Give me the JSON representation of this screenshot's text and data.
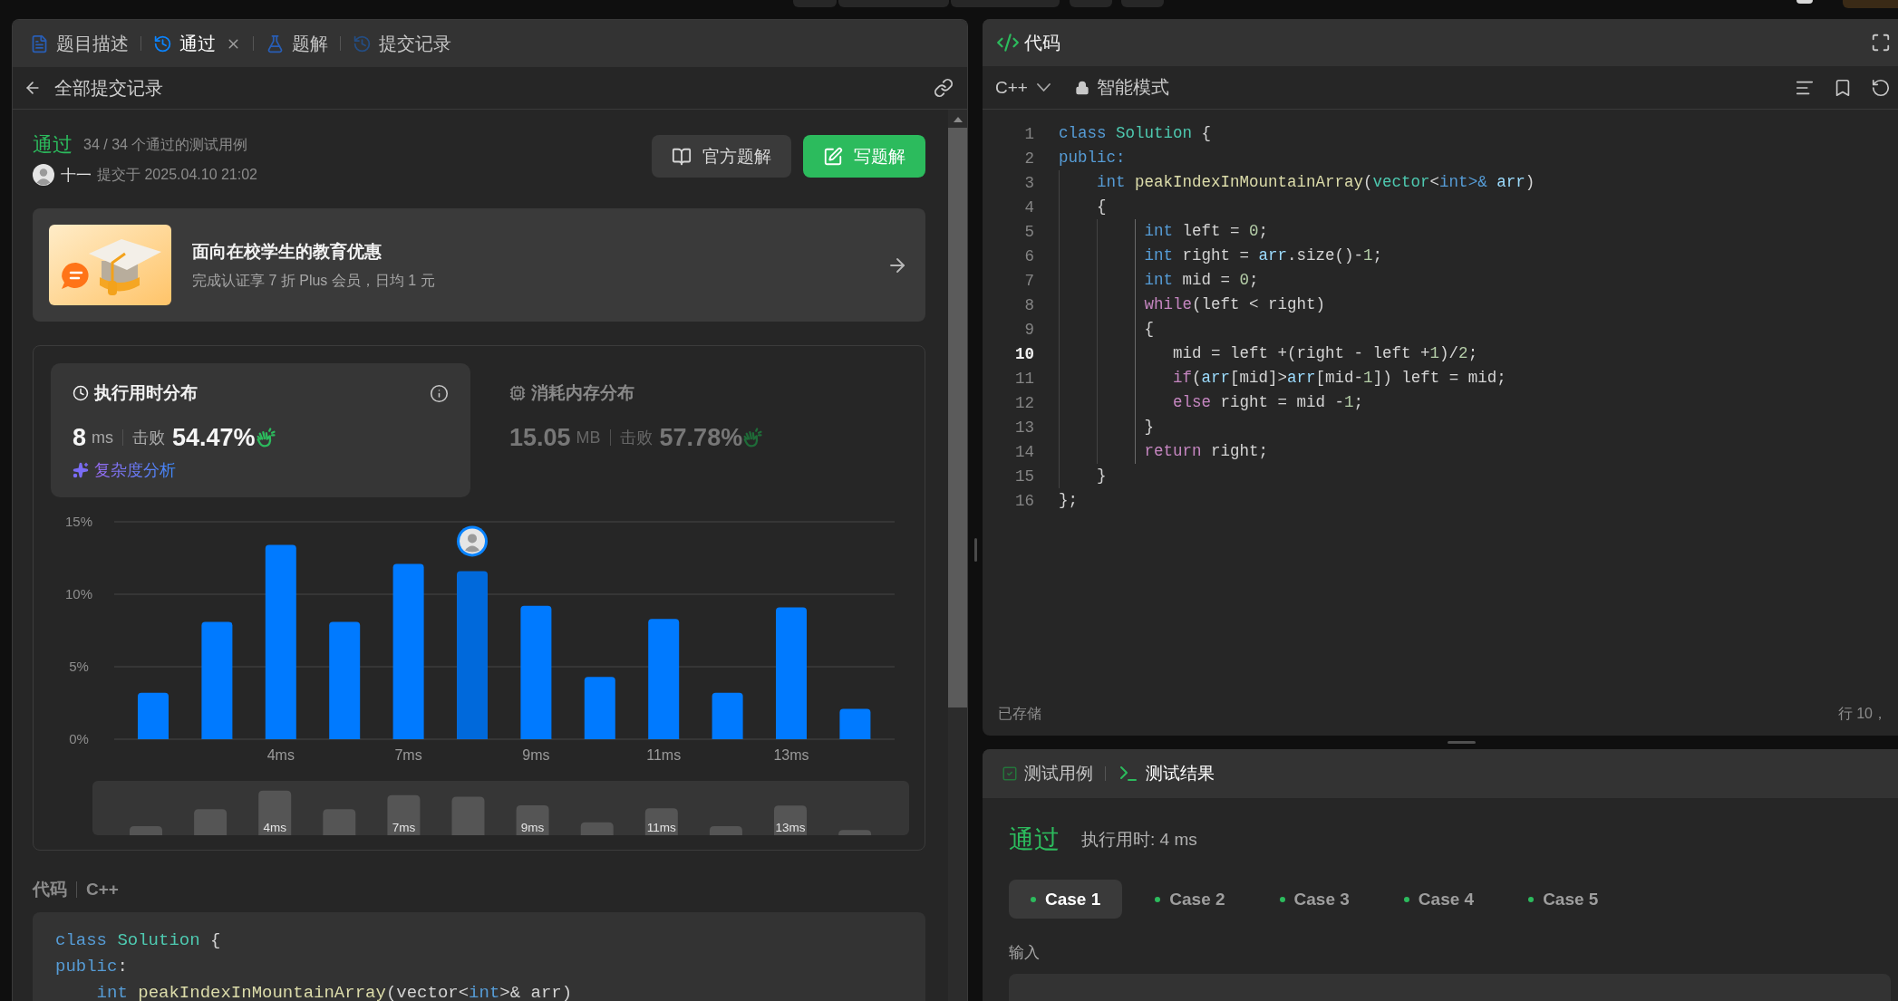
{
  "left_panel": {
    "tabs": [
      {
        "kind": "description",
        "label": "题目描述",
        "selected": false,
        "closable": false
      },
      {
        "kind": "result",
        "label": "通过",
        "selected": true,
        "closable": true
      },
      {
        "kind": "solutions",
        "label": "题解",
        "selected": false,
        "closable": false
      },
      {
        "kind": "submissions",
        "label": "提交记录",
        "selected": false,
        "closable": false
      }
    ],
    "back_link": {
      "label": "全部提交记录"
    },
    "submission": {
      "status": "通过",
      "tests": "34 / 34 个通过的测试用例",
      "user": "十一",
      "submitted": "提交于 2025.04.10 21:02"
    },
    "actions": [
      {
        "kind": "book",
        "label": "官方题解",
        "primary": false
      },
      {
        "kind": "edit",
        "label": "写题解",
        "primary": true
      }
    ],
    "promo": {
      "title": "面向在校学生的教育优惠",
      "subtitle": "完成认证享 7 折 Plus 会员，日均 1 元"
    },
    "metrics": [
      {
        "kind": "time",
        "title": "执行用时分布",
        "value": "8",
        "unit": "ms",
        "beats_label": "击败",
        "beats": "54.47%",
        "link": "复杂度分析",
        "selected": true
      },
      {
        "kind": "memory",
        "title": "消耗内存分布",
        "value": "15.05",
        "unit": "MB",
        "beats_label": "击败",
        "beats": "57.78%",
        "selected": false
      }
    ],
    "chart": {
      "chart_data": {
        "type": "bar",
        "categories": [
          null,
          null,
          "4ms",
          null,
          "7ms",
          null,
          "9ms",
          null,
          "11ms",
          null,
          "13ms",
          null
        ],
        "series": [
          {
            "color": "#007aff",
            "values": [
              3.2,
              8.1,
              13.4,
              8.1,
              12.1,
              null,
              9.2,
              4.3,
              8.3,
              3.2,
              9.1,
              2.1
            ]
          },
          {
            "color": "#0069db",
            "values": [
              null,
              null,
              null,
              null,
              null,
              11.6,
              null,
              null,
              null,
              null,
              null,
              null
            ]
          }
        ],
        "stacked": true,
        "ylim": [
          0,
          15
        ],
        "yticks": [
          {
            "value": 0,
            "label": "0%"
          },
          {
            "value": 5,
            "label": "5%"
          },
          {
            "value": 10,
            "label": "10%"
          },
          {
            "value": 15,
            "label": "15%"
          }
        ]
      }
    },
    "overview": {
      "labels": [
        "4ms",
        "7ms",
        "9ms",
        "11ms",
        "13ms"
      ]
    },
    "code_section": {
      "title": "代码",
      "language": "C++",
      "lines": [
        [
          {
            "text": "class",
            "kind": "kw"
          },
          {
            "text": " Solution",
            "kind": "type"
          },
          {
            "text": " {",
            "kind": "plain"
          }
        ],
        [
          {
            "text": "public",
            "kind": "kw"
          },
          {
            "text": ":",
            "kind": "plain"
          }
        ],
        [
          {
            "text": "    int",
            "kind": "kw"
          },
          {
            "text": " peakIndexInMountainArray",
            "kind": "fn"
          },
          {
            "text": "(vector<",
            "kind": "plain"
          },
          {
            "text": "int",
            "kind": "kw"
          },
          {
            "text": ">& arr)",
            "kind": "plain"
          }
        ]
      ]
    }
  },
  "editor": {
    "title": "代码",
    "language": "C++",
    "mode": "智能模式",
    "lines": [
      {
        "number": "1",
        "current": false,
        "tokens": [
          {
            "text": "class",
            "kind": "kw"
          },
          {
            "text": " Solution",
            "kind": "type"
          },
          {
            "text": " {",
            "kind": "plain"
          }
        ]
      },
      {
        "number": "2",
        "current": false,
        "tokens": [
          {
            "text": "public:",
            "kind": "kw"
          }
        ]
      },
      {
        "number": "3",
        "current": false,
        "tokens": [
          {
            "text": "    int",
            "kind": "kw"
          },
          {
            "text": " peakIndexInMountainArray",
            "kind": "fn"
          },
          {
            "text": "(",
            "kind": "plain"
          },
          {
            "text": "vector",
            "kind": "type"
          },
          {
            "text": "<",
            "kind": "plain"
          },
          {
            "text": "int",
            "kind": "kw"
          },
          {
            "text": ">&",
            "kind": "kw"
          },
          {
            "text": " arr",
            "kind": "var"
          },
          {
            "text": ")",
            "kind": "plain"
          }
        ]
      },
      {
        "number": "4",
        "current": false,
        "tokens": [
          {
            "text": "    {",
            "kind": "plain"
          }
        ]
      },
      {
        "number": "5",
        "current": false,
        "tokens": [
          {
            "text": "         int",
            "kind": "kw"
          },
          {
            "text": " left = ",
            "kind": "plain"
          },
          {
            "text": "0",
            "kind": "num"
          },
          {
            "text": ";",
            "kind": "plain"
          }
        ]
      },
      {
        "number": "6",
        "current": false,
        "tokens": [
          {
            "text": "         int",
            "kind": "kw"
          },
          {
            "text": " right = ",
            "kind": "plain"
          },
          {
            "text": "arr",
            "kind": "var"
          },
          {
            "text": ".size()-",
            "kind": "plain"
          },
          {
            "text": "1",
            "kind": "num"
          },
          {
            "text": ";",
            "kind": "plain"
          }
        ]
      },
      {
        "number": "7",
        "current": false,
        "tokens": [
          {
            "text": "         int",
            "kind": "kw"
          },
          {
            "text": " mid = ",
            "kind": "plain"
          },
          {
            "text": "0",
            "kind": "num"
          },
          {
            "text": ";",
            "kind": "plain"
          }
        ]
      },
      {
        "number": "8",
        "current": false,
        "tokens": [
          {
            "text": "         while",
            "kind": "ctrl"
          },
          {
            "text": "(left < right)",
            "kind": "plain"
          }
        ]
      },
      {
        "number": "9",
        "current": false,
        "tokens": [
          {
            "text": "         {",
            "kind": "plain"
          }
        ]
      },
      {
        "number": "10",
        "current": true,
        "tokens": [
          {
            "text": "            mid = left +(right - left +",
            "kind": "plain"
          },
          {
            "text": "1",
            "kind": "num"
          },
          {
            "text": ")/",
            "kind": "plain"
          },
          {
            "text": "2",
            "kind": "num"
          },
          {
            "text": ";",
            "kind": "plain"
          }
        ]
      },
      {
        "number": "11",
        "current": false,
        "tokens": [
          {
            "text": "            if",
            "kind": "ctrl"
          },
          {
            "text": "(",
            "kind": "plain"
          },
          {
            "text": "arr",
            "kind": "var"
          },
          {
            "text": "[mid]>",
            "kind": "plain"
          },
          {
            "text": "arr",
            "kind": "var"
          },
          {
            "text": "[mid-",
            "kind": "plain"
          },
          {
            "text": "1",
            "kind": "num"
          },
          {
            "text": "]) left = mid;",
            "kind": "plain"
          }
        ]
      },
      {
        "number": "12",
        "current": false,
        "tokens": [
          {
            "text": "            else",
            "kind": "ctrl"
          },
          {
            "text": " right = mid -",
            "kind": "plain"
          },
          {
            "text": "1",
            "kind": "num"
          },
          {
            "text": ";",
            "kind": "plain"
          }
        ]
      },
      {
        "number": "13",
        "current": false,
        "tokens": [
          {
            "text": "         }",
            "kind": "plain"
          }
        ]
      },
      {
        "number": "14",
        "current": false,
        "tokens": [
          {
            "text": "         return",
            "kind": "ctrl"
          },
          {
            "text": " right;",
            "kind": "plain"
          }
        ]
      },
      {
        "number": "15",
        "current": false,
        "tokens": [
          {
            "text": "    }",
            "kind": "plain"
          }
        ]
      },
      {
        "number": "16",
        "current": false,
        "tokens": [
          {
            "text": "};",
            "kind": "plain"
          }
        ]
      }
    ],
    "saved": "已存储",
    "cursor": "行 10，"
  },
  "results": {
    "tabs": [
      {
        "kind": "testcase",
        "label": "测试用例",
        "selected": false
      },
      {
        "kind": "result",
        "label": "测试结果",
        "selected": true
      }
    ],
    "status": "通过",
    "runtime": "执行用时: 4 ms",
    "cases": [
      {
        "label": "Case 1",
        "selected": true
      },
      {
        "label": "Case 2",
        "selected": false
      },
      {
        "label": "Case 3",
        "selected": false
      },
      {
        "label": "Case 4",
        "selected": false
      },
      {
        "label": "Case 5",
        "selected": false
      }
    ],
    "input_label": "输入"
  }
}
